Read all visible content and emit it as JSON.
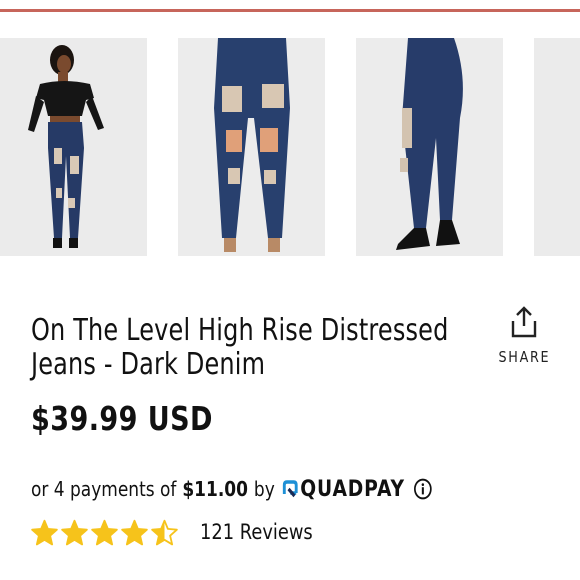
{
  "product": {
    "title_line1": "On The Level High Rise Distressed",
    "title_line2": "Jeans - Dark Denim",
    "price": "$39.99 USD"
  },
  "share": {
    "label": "SHARE",
    "icon": "share-icon"
  },
  "payments": {
    "prefix": "or 4 payments of",
    "amount": "$11.00",
    "by": "by",
    "provider": "QUADPAY",
    "info_icon": "info-icon"
  },
  "rating": {
    "stars": 4.5,
    "max": 5,
    "reviews_text": "121 Reviews"
  },
  "colors": {
    "accent_rule": "#c7655b",
    "star": "#f6c31b",
    "quadpay_blue": "#1e90d6",
    "text": "#111111"
  }
}
